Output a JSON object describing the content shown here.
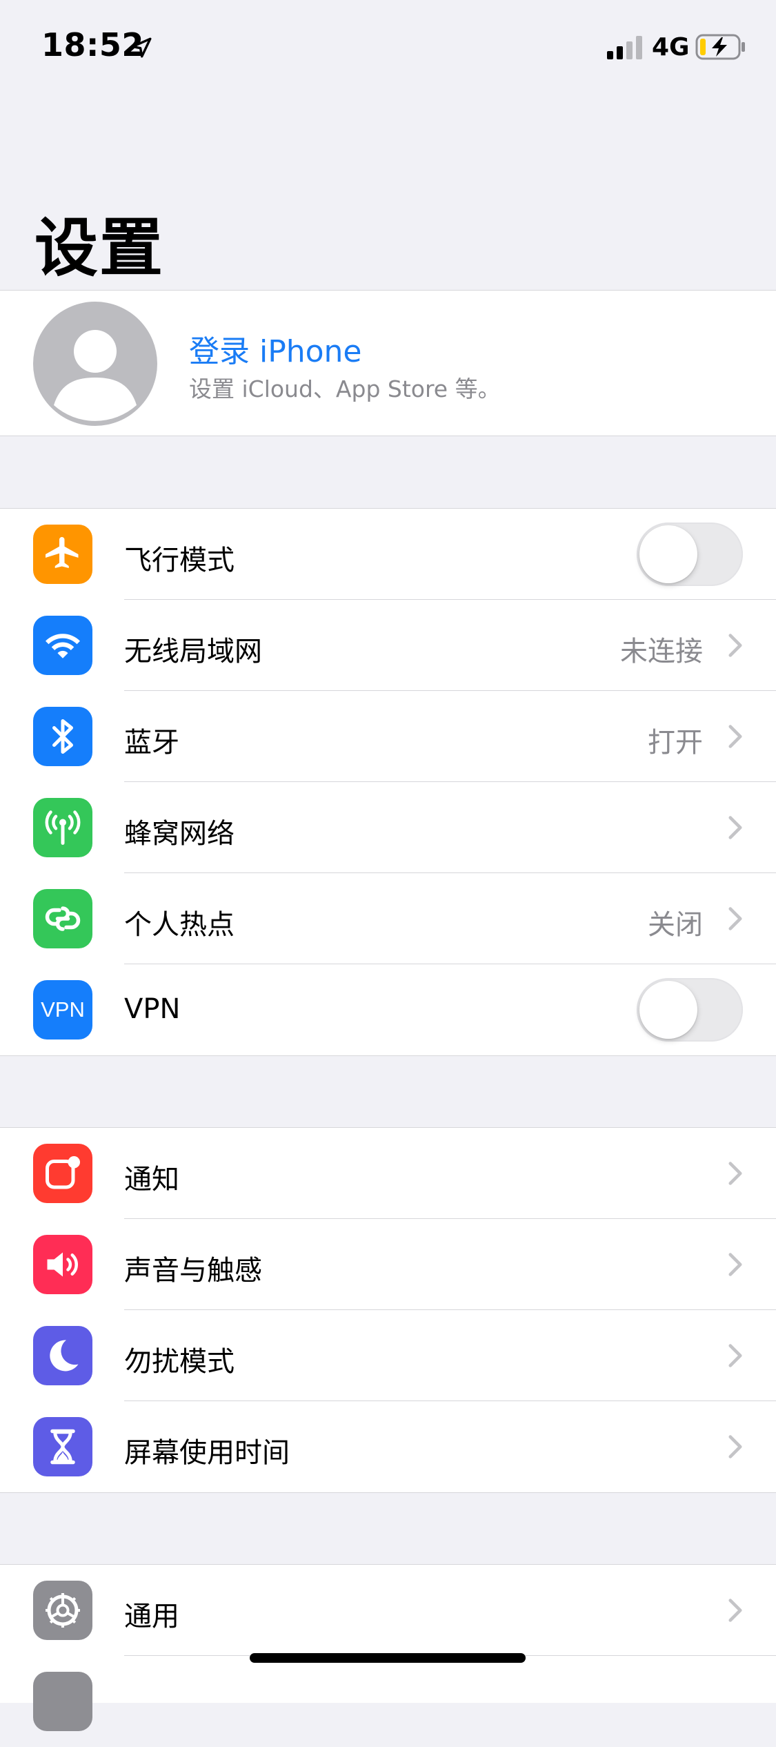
{
  "status_bar": {
    "time": "18:52",
    "network": "4G"
  },
  "header": {
    "title": "设置"
  },
  "profile": {
    "title": "登录 iPhone",
    "subtitle": "设置 iCloud、App Store 等。"
  },
  "group1": [
    {
      "label": "飞行模式",
      "icon": "airplane-icon",
      "color": "#ff9500",
      "type": "toggle",
      "on": false
    },
    {
      "label": "无线局域网",
      "icon": "wifi-icon",
      "color": "#157efb",
      "type": "detail",
      "value": "未连接"
    },
    {
      "label": "蓝牙",
      "icon": "bluetooth-icon",
      "color": "#157efb",
      "type": "detail",
      "value": "打开"
    },
    {
      "label": "蜂窝网络",
      "icon": "cellular-icon",
      "color": "#34c759",
      "type": "detail",
      "value": ""
    },
    {
      "label": "个人热点",
      "icon": "hotspot-icon",
      "color": "#34c759",
      "type": "detail",
      "value": "关闭"
    },
    {
      "label": "VPN",
      "icon": "vpn-icon",
      "icon_text": "VPN",
      "color": "#157efb",
      "type": "toggle",
      "on": false
    }
  ],
  "group2": [
    {
      "label": "通知",
      "icon": "notifications-icon",
      "color": "#ff3b30",
      "type": "detail",
      "value": ""
    },
    {
      "label": "声音与触感",
      "icon": "sound-icon",
      "color": "#ff2d55",
      "type": "detail",
      "value": ""
    },
    {
      "label": "勿扰模式",
      "icon": "moon-icon",
      "color": "#5e5ce6",
      "type": "detail",
      "value": ""
    },
    {
      "label": "屏幕使用时间",
      "icon": "hourglass-icon",
      "color": "#5e5ce6",
      "type": "detail",
      "value": ""
    }
  ],
  "group3": [
    {
      "label": "通用",
      "icon": "gear-icon",
      "color": "#8e8e93",
      "type": "detail",
      "value": ""
    }
  ]
}
